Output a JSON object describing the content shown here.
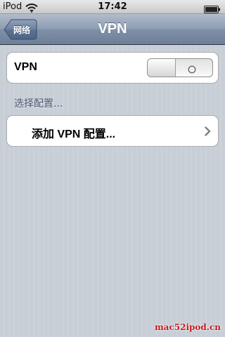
{
  "status_bar": {
    "carrier": "iPod",
    "time": "17:42",
    "wifi_icon": "wifi-icon",
    "battery_icon": "battery-full-icon"
  },
  "nav": {
    "back_label": "网络",
    "title": "VPN"
  },
  "vpn_row": {
    "label": "VPN",
    "toggle_state": "off"
  },
  "section": {
    "header": "选择配置..."
  },
  "add_row": {
    "label": "添加 VPN 配置...",
    "chevron_icon": "chevron-right-icon"
  },
  "watermark": "mac52ipod.cn",
  "colors": {
    "nav_bar": "#8c9cb1",
    "background": "#c5ccd4",
    "section_header": "#4c566c",
    "watermark": "#c4161c"
  }
}
